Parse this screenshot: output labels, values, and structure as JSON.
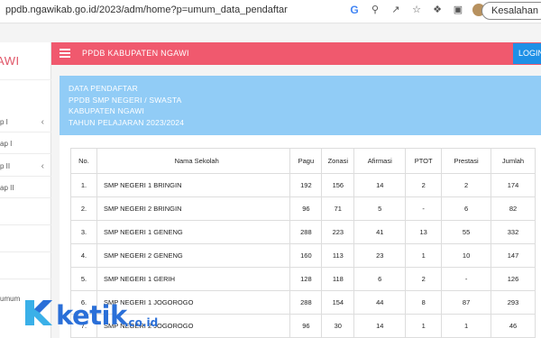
{
  "browser": {
    "url": "ppdb.ngawikab.go.id/2023/adm/home?p=umum_data_pendaftar",
    "profile_button": "Kesalahan",
    "icons": [
      "google-icon",
      "zoom-icon",
      "share-icon",
      "star-icon",
      "extensions-icon",
      "sidebar-icon",
      "avatar"
    ]
  },
  "sidebar": {
    "brand": "AWI",
    "items": [
      {
        "label": "p I",
        "has_chevron": true
      },
      {
        "label": "ap I",
        "has_chevron": false
      },
      {
        "label": "p II",
        "has_chevron": true
      },
      {
        "label": "ap II",
        "has_chevron": false
      },
      {
        "label": "umum",
        "has_chevron": false
      }
    ]
  },
  "navbar": {
    "title": "PPDB KABUPATEN NGAWI",
    "login": "LOGIN"
  },
  "info": {
    "lines": [
      "DATA PENDAFTAR",
      "PPDB SMP NEGERI / SWASTA",
      "KABUPATEN NGAWI",
      "TAHUN PELAJARAN 2023/2024"
    ]
  },
  "table": {
    "headers": [
      "No.",
      "Nama Sekolah",
      "Pagu",
      "Zonasi",
      "Afirmasi",
      "PTOT",
      "Prestasi",
      "Jumlah"
    ],
    "rows": [
      [
        "1.",
        "SMP NEGERI 1 BRINGIN",
        "192",
        "156",
        "14",
        "2",
        "2",
        "174"
      ],
      [
        "2.",
        "SMP NEGERI 2 BRINGIN",
        "96",
        "71",
        "5",
        "-",
        "6",
        "82"
      ],
      [
        "3.",
        "SMP NEGERI 1 GENENG",
        "288",
        "223",
        "41",
        "13",
        "55",
        "332"
      ],
      [
        "4.",
        "SMP NEGERI 2 GENENG",
        "160",
        "113",
        "23",
        "1",
        "10",
        "147"
      ],
      [
        "5.",
        "SMP NEGERI 1 GERIH",
        "128",
        "118",
        "6",
        "2",
        "-",
        "126"
      ],
      [
        "6.",
        "SMP NEGERI 1 JOGOROGO",
        "288",
        "154",
        "44",
        "8",
        "87",
        "293"
      ],
      [
        "7.",
        "SMP NEGERI 2 JOGOROGO",
        "96",
        "30",
        "14",
        "1",
        "1",
        "46"
      ]
    ]
  },
  "watermark": {
    "brand": "ketik",
    "suffix": ".co.id",
    "color": "#2a6fd8"
  },
  "colors": {
    "navbar": "#f0596e",
    "info_box": "#91ccf6",
    "login": "#1e90e6"
  }
}
